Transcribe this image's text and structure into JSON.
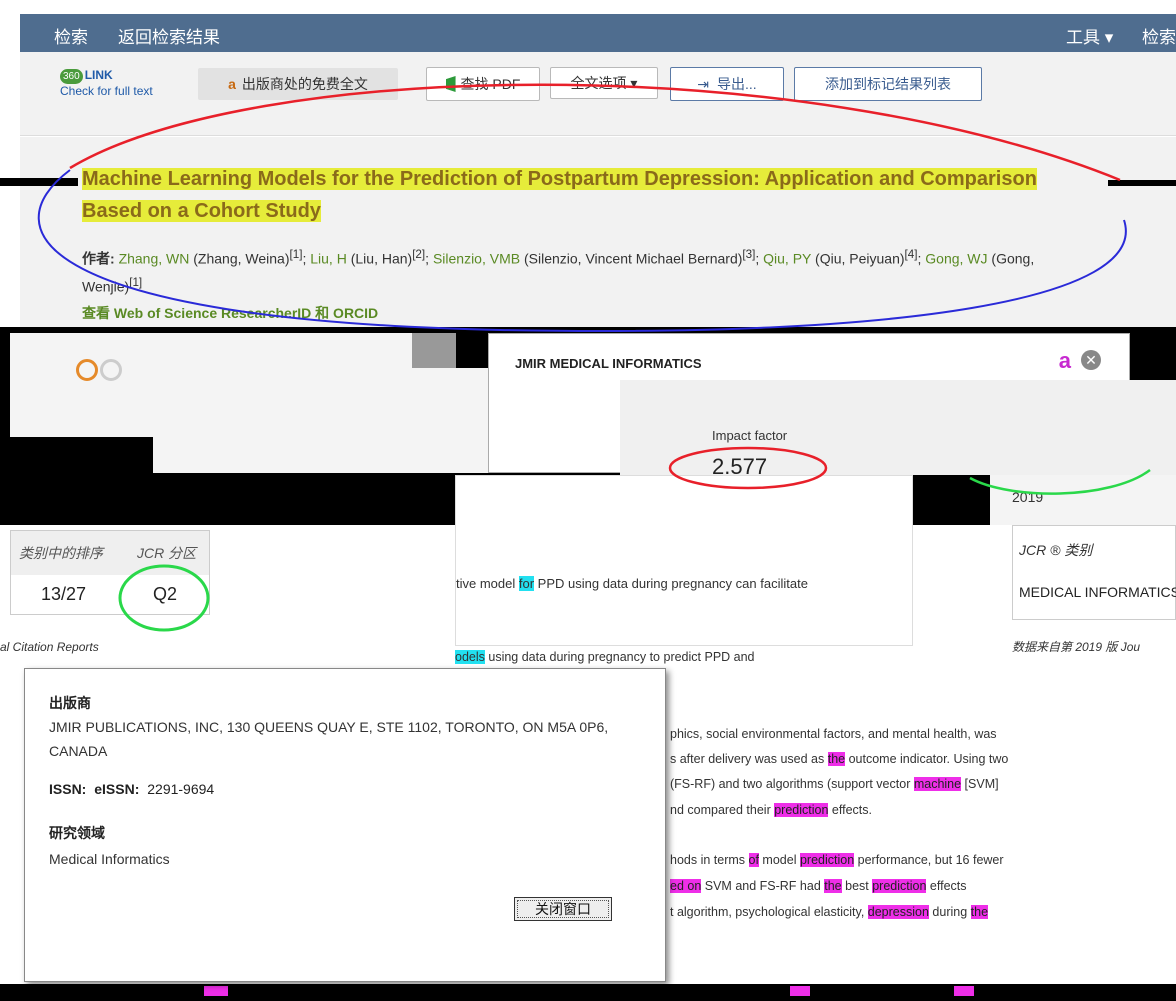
{
  "nav": {
    "search": "检索",
    "back": "返回检索结果",
    "tools": "工具 ▾",
    "right": "检索"
  },
  "toolbar": {
    "link360_badge": "360",
    "link360_title": "LINK",
    "link360_sub": "Check for full text",
    "free_fulltext": "出版商处的免费全文",
    "find_pdf": "查找 PDF",
    "fulltext_options": "全文选项 ▾",
    "export": "导出...",
    "add_marked": "添加到标记结果列表"
  },
  "record": {
    "title_line1": "Machine Learning Models for the Prediction of Postpartum Depression: Application and Comparison",
    "title_line2": "Based on a Cohort Study",
    "authors_label": "作者:",
    "authors": [
      {
        "short": "Zhang, WN",
        "full": "(Zhang, Weina)",
        "ref": "[1]"
      },
      {
        "short": "Liu, H",
        "full": "(Liu, Han)",
        "ref": "[2]"
      },
      {
        "short": "Silenzio, VMB",
        "full": "(Silenzio, Vincent Michael Bernard)",
        "ref": "[3]"
      },
      {
        "short": "Qiu, PY",
        "full": "(Qiu, Peiyuan)",
        "ref": "[4]"
      },
      {
        "short": "Gong, WJ",
        "full": "(Gong,",
        "ref": ""
      }
    ],
    "authors_cont": "Wenjie)",
    "authors_cont_ref": "[1]",
    "researcher_link": "查看 Web of Science ResearcherID 和 ORCID"
  },
  "journal": {
    "name": "JMIR MEDICAL INFORMATICS",
    "impact_label": "Impact factor",
    "impact_value": "2.577",
    "year": "2019"
  },
  "jcr_table": {
    "col_rank": "类别中的排序",
    "col_quartile": "JCR 分区",
    "rank": "13/27",
    "quartile": "Q2",
    "source": "al Citation Reports"
  },
  "jcr_category": {
    "label": "JCR ® 类别",
    "value": "MEDICAL INFORMATICS",
    "footnote": "数据来自第 2019 版 Jou"
  },
  "center_card": {
    "text_pre": "tive model ",
    "text_hl": "for",
    "text_post": " PPD using data during pregnancy can facilitate"
  },
  "popup": {
    "publisher_label": "出版商",
    "publisher_value": "JMIR PUBLICATIONS, INC, 130 QUEENS QUAY E, STE 1102, TORONTO, ON M5A 0P6, CANADA",
    "issn_label": "ISSN:",
    "eissn_label": "eISSN:",
    "eissn_value": "2291-9694",
    "research_label": "研究领域",
    "research_value": "Medical Informatics",
    "close_button": "关闭窗口"
  },
  "abstract": {
    "l0_hl": "odels",
    "l0_rest": " using data during pregnancy to predict PPD and",
    "l1": "phics, social environmental factors, and mental health, was",
    "l2_pre": "s after delivery was used as ",
    "l2_hl": "the",
    "l2_post": " outcome indicator. Using two",
    "l3_pre": "(FS-RF) and two algorithms (support vector ",
    "l3_hl": "machine",
    "l3_post": " [SVM]",
    "l4_pre": "nd compared their ",
    "l4_hl": "prediction",
    "l4_post": " effects.",
    "l5_pre": "hods in terms ",
    "l5_hl1": "of",
    "l5_mid": " model ",
    "l5_hl2": "prediction",
    "l5_post": " performance, but 16 fewer",
    "l6_hl1": "ed on",
    "l6_mid": " SVM and FS-RF had ",
    "l6_hl2": "the",
    "l6_mid2": " best ",
    "l6_hl3": "prediction",
    "l6_post": " effects",
    "l7_pre": "t algorithm, psychological elasticity, ",
    "l7_hl1": "depression",
    "l7_mid": " during ",
    "l7_hl2": "the"
  },
  "colors": {
    "nav_bg": "#4f6d8f",
    "highlight_yellow": "#e6ec3a",
    "highlight_magenta": "#ee2ee8",
    "annotation_red": "#e8202a",
    "annotation_blue": "#2a2ad8",
    "annotation_green": "#2ad84a"
  }
}
